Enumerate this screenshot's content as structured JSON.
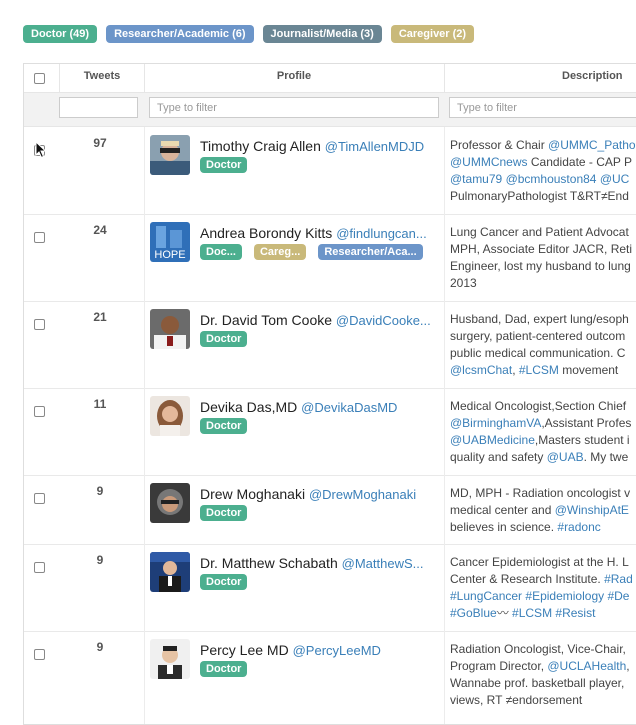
{
  "filter_tags": [
    {
      "label": "Doctor (49)",
      "color": "#4caf8f"
    },
    {
      "label": "Researcher/Academic (6)",
      "color": "#6c95c9"
    },
    {
      "label": "Journalist/Media (3)",
      "color": "#6a8694"
    },
    {
      "label": "Caregiver (2)",
      "color": "#c9b97a"
    }
  ],
  "table": {
    "headers": {
      "tweets": "Tweets",
      "profile": "Profile",
      "description": "Description"
    },
    "filter_placeholder": "Type to filter"
  },
  "rows": [
    {
      "tweets": "97",
      "name": "Timothy Craig Allen",
      "handle": "@TimAllenMDJD",
      "tags": [
        "Doctor"
      ],
      "desc": [
        [
          [
            "Professor & Chair ",
            0
          ],
          [
            "@UMMC_Patho",
            1
          ]
        ],
        [
          [
            "@UMMCnews",
            1
          ],
          [
            " Candidate - CAP P",
            0
          ]
        ],
        [
          [
            "@tamu79",
            1
          ],
          [
            " ",
            0
          ],
          [
            "@bcmhouston84",
            1
          ],
          [
            " ",
            0
          ],
          [
            "@UC",
            1
          ]
        ],
        [
          [
            "PulmonaryPathologist T&RT≠End",
            0
          ]
        ]
      ]
    },
    {
      "tweets": "24",
      "name": "Andrea Borondy Kitts",
      "handle": "@findlungcan...",
      "tags": [
        "Doc...",
        "Careg...",
        "Researcher/Aca..."
      ],
      "desc": [
        [
          [
            "Lung Cancer and Patient Advocat",
            0
          ]
        ],
        [
          [
            "MPH, Associate Editor JACR, Reti",
            0
          ]
        ],
        [
          [
            "Engineer, lost my husband to lung",
            0
          ]
        ],
        [
          [
            "2013",
            0
          ]
        ]
      ]
    },
    {
      "tweets": "21",
      "name": "Dr. David Tom Cooke",
      "handle": "@DavidCooke...",
      "tags": [
        "Doctor"
      ],
      "desc": [
        [
          [
            "Husband, Dad, expert lung/esoph",
            0
          ]
        ],
        [
          [
            "surgery, patient-centered outcom",
            0
          ]
        ],
        [
          [
            "public medical communication. C",
            0
          ]
        ],
        [
          [
            "@lcsmChat",
            1
          ],
          [
            ", ",
            0
          ],
          [
            "#LCSM",
            1
          ],
          [
            " movement",
            0
          ]
        ]
      ]
    },
    {
      "tweets": "11",
      "name": "Devika Das,MD",
      "handle": "@DevikaDasMD",
      "tags": [
        "Doctor"
      ],
      "desc": [
        [
          [
            "Medical Oncologist,Section Chief",
            0
          ]
        ],
        [
          [
            "@BirminghamVA",
            1
          ],
          [
            ",Assistant Profes",
            0
          ]
        ],
        [
          [
            "@UABMedicine",
            1
          ],
          [
            ",Masters student i",
            0
          ]
        ],
        [
          [
            "quality and safety ",
            0
          ],
          [
            "@UAB",
            1
          ],
          [
            ". My twe",
            0
          ]
        ]
      ]
    },
    {
      "tweets": "9",
      "name": "Drew Moghanaki",
      "handle": "@DrewMoghanaki",
      "tags": [
        "Doctor"
      ],
      "desc": [
        [
          [
            "MD, MPH - Radiation oncologist v",
            0
          ]
        ],
        [
          [
            "medical center and ",
            0
          ],
          [
            "@WinshipAtE",
            1
          ]
        ],
        [
          [
            "believes in science. ",
            0
          ],
          [
            "#radonc",
            1
          ]
        ]
      ]
    },
    {
      "tweets": "9",
      "name": "Dr. Matthew Schabath",
      "handle": "@MatthewS...",
      "tags": [
        "Doctor"
      ],
      "desc": [
        [
          [
            "Cancer Epidemiologist at the H. L",
            0
          ]
        ],
        [
          [
            "Center & Research Institute. ",
            0
          ],
          [
            "#Rad",
            1
          ]
        ],
        [
          [
            "#LungCancer",
            1
          ],
          [
            " ",
            0
          ],
          [
            "#Epidemiology",
            1
          ],
          [
            " ",
            0
          ],
          [
            "#De",
            1
          ]
        ],
        [
          [
            "#GoBlue",
            1
          ],
          [
            "〰 ",
            0
          ],
          [
            "#LCSM",
            1
          ],
          [
            " ",
            0
          ],
          [
            "#Resist",
            1
          ]
        ]
      ]
    },
    {
      "tweets": "9",
      "name": "Percy Lee MD",
      "handle": "@PercyLeeMD",
      "tags": [
        "Doctor"
      ],
      "desc": [
        [
          [
            "Radiation Oncologist, Vice-Chair,",
            0
          ]
        ],
        [
          [
            "Program Director, ",
            0
          ],
          [
            "@UCLAHealth",
            1
          ],
          [
            ",",
            0
          ]
        ],
        [
          [
            "Wannabe prof. basketball player,",
            0
          ]
        ],
        [
          [
            "views, RT ≠endorsement",
            0
          ]
        ]
      ]
    }
  ]
}
